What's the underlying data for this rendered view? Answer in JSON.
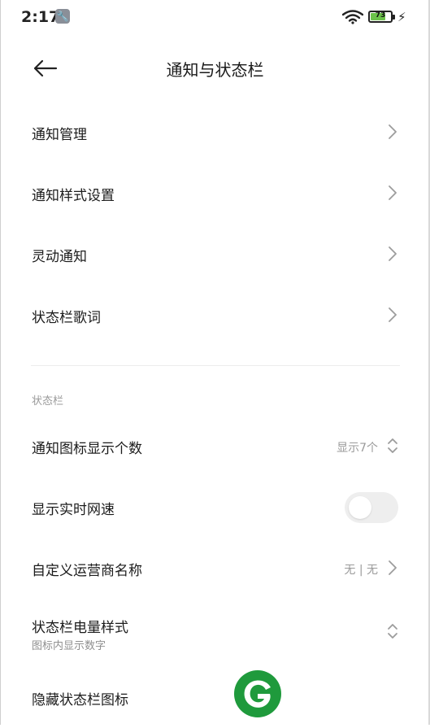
{
  "status_bar": {
    "time": "2:17",
    "battery_level": "73",
    "icons": [
      "wrench-icon",
      "wifi-icon",
      "battery-icon",
      "charging-bolt-icon"
    ]
  },
  "header": {
    "back_icon": "back-arrow-icon",
    "title": "通知与状态栏"
  },
  "items": [
    {
      "label": "通知管理",
      "icon": "chevron-right-icon"
    },
    {
      "label": "通知样式设置",
      "icon": "chevron-right-icon"
    },
    {
      "label": "灵动通知",
      "icon": "chevron-right-icon"
    },
    {
      "label": "状态栏歌词",
      "icon": "chevron-right-icon"
    }
  ],
  "section": {
    "title": "状态栏",
    "items": [
      {
        "label": "通知图标显示个数",
        "value": "显示7个",
        "icon": "updown-icon"
      },
      {
        "label": "显示实时网速",
        "toggle_on": false
      },
      {
        "label": "自定义运营商名称",
        "value": "无 | 无",
        "icon": "chevron-right-icon"
      },
      {
        "label": "状态栏电量样式",
        "sublabel": "图标内显示数字",
        "icon": "updown-icon"
      },
      {
        "label": "隐藏状态栏图标"
      }
    ]
  },
  "colors": {
    "battery_fill": "#6bc24a",
    "watermark_green": "#1f9a3c",
    "toggle_off_track": "#eeeeee"
  }
}
